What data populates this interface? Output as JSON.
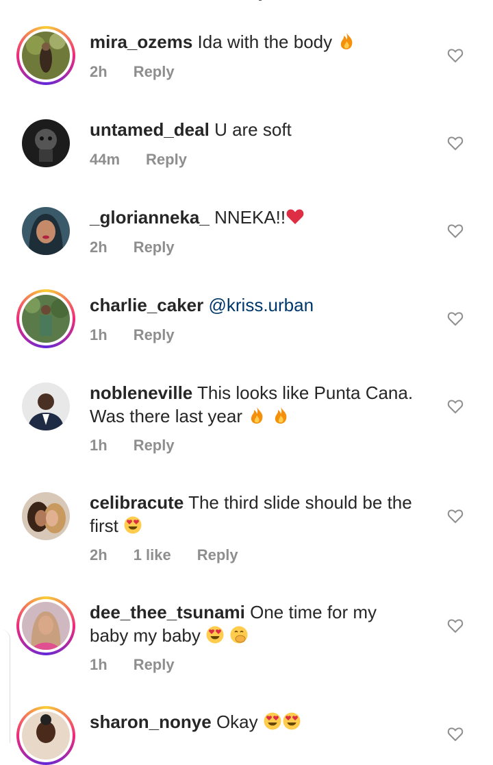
{
  "comments": [
    {
      "username": "mira_ozems",
      "text": "Ida with the body",
      "emoji": [
        "fire"
      ],
      "time": "2h",
      "likes": "",
      "reply": "Reply",
      "ring": true
    },
    {
      "username": "untamed_deal",
      "text": "U are soft",
      "emoji": [],
      "time": "44m",
      "likes": "",
      "reply": "Reply",
      "ring": false
    },
    {
      "username": "_glorianneka_",
      "text": "NNEKA!!",
      "emoji": [
        "red-heart"
      ],
      "time": "2h",
      "likes": "",
      "reply": "Reply",
      "ring": false
    },
    {
      "username": "charlie_caker",
      "mention": "@kriss.urban",
      "emoji": [],
      "time": "1h",
      "likes": "",
      "reply": "Reply",
      "ring": true
    },
    {
      "username": "nobleneville",
      "text": "This looks like Punta Cana.",
      "text2": "Was there last year",
      "emoji": [
        "fire",
        "fire"
      ],
      "time": "1h",
      "likes": "",
      "reply": "Reply",
      "ring": false
    },
    {
      "username": "celibracute",
      "text": "The third slide should be the",
      "text2": "first",
      "emoji": [
        "heart-eyes"
      ],
      "time": "2h",
      "likes": "1 like",
      "reply": "Reply",
      "ring": false
    },
    {
      "username": "dee_thee_tsunami",
      "text": "One time for my",
      "text2": "baby my baby",
      "emoji": [
        "heart-eyes",
        "hand-over-mouth"
      ],
      "time": "1h",
      "likes": "",
      "reply": "Reply",
      "ring": true
    },
    {
      "username": "sharon_nonye",
      "text": "Okay",
      "emoji": [
        "heart-eyes",
        "heart-eyes"
      ],
      "time": "",
      "likes": "",
      "reply": "",
      "ring": true
    }
  ],
  "colors": {
    "username": "#262626",
    "meta": "#8e8e8e",
    "mention": "#00376b",
    "ring": "#ee2a7b"
  }
}
